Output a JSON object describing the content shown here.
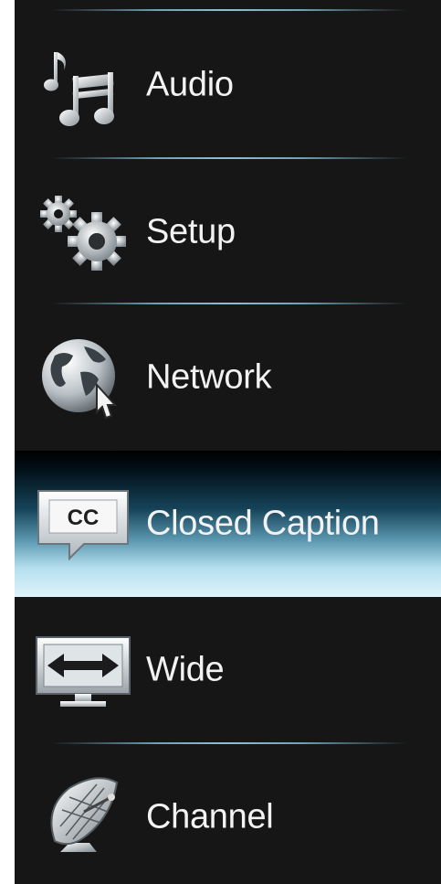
{
  "menu": {
    "selected_index": 3,
    "items": [
      {
        "label": "Audio",
        "icon": "music-note-icon"
      },
      {
        "label": "Setup",
        "icon": "gears-icon"
      },
      {
        "label": "Network",
        "icon": "globe-cursor-icon"
      },
      {
        "label": "Closed Caption",
        "icon": "closed-caption-icon",
        "icon_text": "CC"
      },
      {
        "label": "Wide",
        "icon": "widescreen-tv-icon"
      },
      {
        "label": "Channel",
        "icon": "satellite-dish-icon"
      }
    ]
  },
  "colors": {
    "background": "#161616",
    "text": "#f2f2f2",
    "divider": "#8fbfcf",
    "highlight_top": "#000000",
    "highlight_bottom": "#dff3fa"
  }
}
